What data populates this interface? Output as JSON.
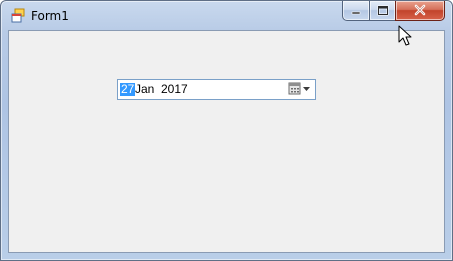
{
  "window": {
    "title": "Form1"
  },
  "title_icons": {
    "app": "form-icon",
    "minimize": "minimize-icon",
    "maximize": "maximize-icon",
    "close": "close-icon"
  },
  "date_picker": {
    "day": "27",
    "month": "Jan",
    "year": "2017",
    "dropdown_icon": "calendar-dropdown-icon"
  }
}
